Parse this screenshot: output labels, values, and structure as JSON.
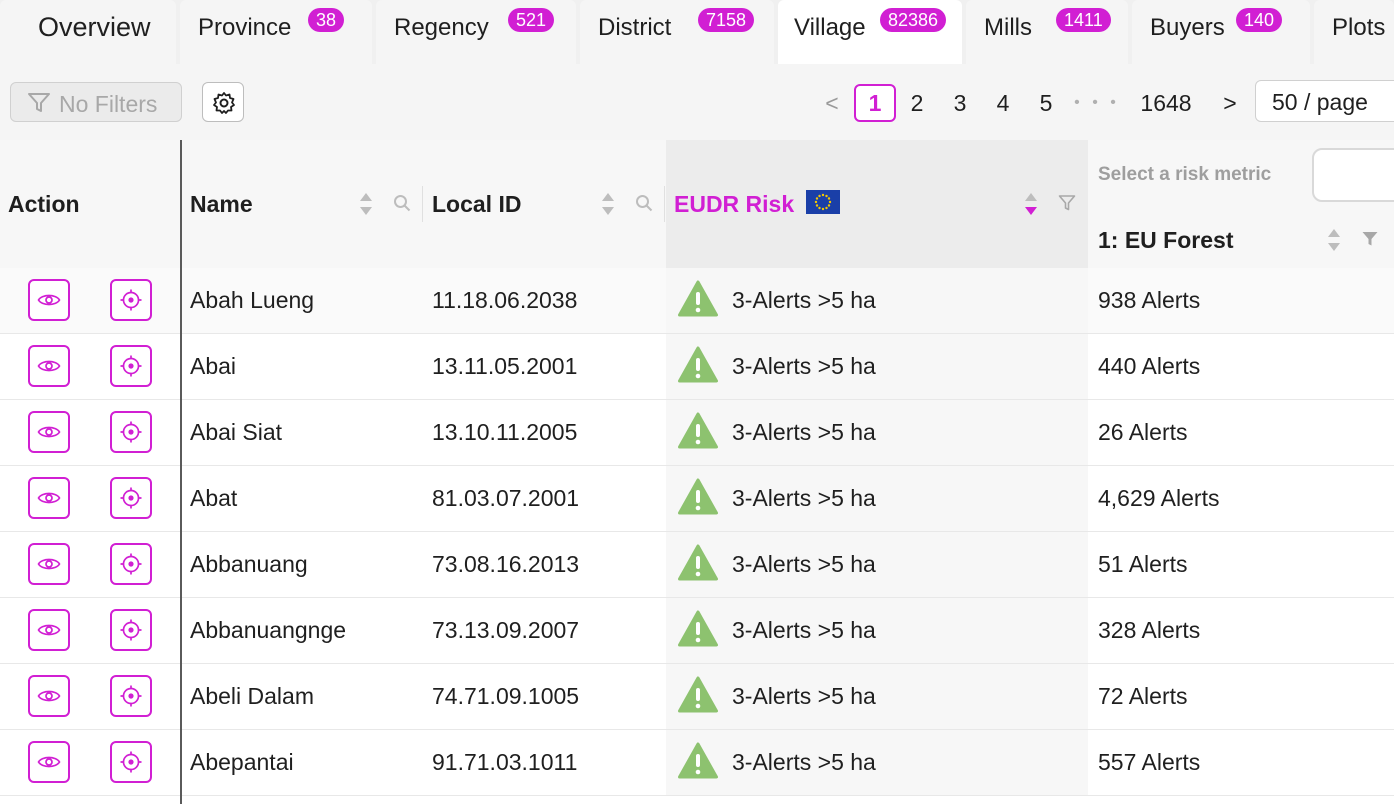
{
  "tabs": [
    {
      "label": "Overview",
      "count": ""
    },
    {
      "label": "Province",
      "count": "38"
    },
    {
      "label": "Regency",
      "count": "521"
    },
    {
      "label": "District",
      "count": "7158"
    },
    {
      "label": "Village",
      "count": "82386"
    },
    {
      "label": "Mills",
      "count": "1411"
    },
    {
      "label": "Buyers",
      "count": "140"
    },
    {
      "label": "Plots",
      "count": ""
    }
  ],
  "active_tab": "Village",
  "toolbar": {
    "filter_label": "No Filters",
    "pagination": {
      "prev": "<",
      "pages": [
        "1",
        "2",
        "3",
        "4",
        "5"
      ],
      "current": "1",
      "ellipsis": "• • •",
      "last": "1648",
      "next": ">"
    },
    "page_size": "50 / page"
  },
  "table": {
    "headers": {
      "action": "Action",
      "name": "Name",
      "local_id": "Local ID",
      "eudr_risk": "EUDR Risk",
      "metric_prompt": "Select a risk metric",
      "metric": "1: EU Forest"
    },
    "rows": [
      {
        "name": "Abah Lueng",
        "local_id": "11.18.06.2038",
        "risk": "3-Alerts >5 ha",
        "alerts": "938 Alerts"
      },
      {
        "name": "Abai",
        "local_id": "13.11.05.2001",
        "risk": "3-Alerts >5 ha",
        "alerts": "440 Alerts"
      },
      {
        "name": "Abai Siat",
        "local_id": "13.10.11.2005",
        "risk": "3-Alerts >5 ha",
        "alerts": "26 Alerts"
      },
      {
        "name": "Abat",
        "local_id": "81.03.07.2001",
        "risk": "3-Alerts >5 ha",
        "alerts": "4,629 Alerts"
      },
      {
        "name": "Abbanuang",
        "local_id": "73.08.16.2013",
        "risk": "3-Alerts >5 ha",
        "alerts": "51 Alerts"
      },
      {
        "name": "Abbanuangnge",
        "local_id": "73.13.09.2007",
        "risk": "3-Alerts >5 ha",
        "alerts": "328 Alerts"
      },
      {
        "name": "Abeli Dalam",
        "local_id": "74.71.09.1005",
        "risk": "3-Alerts >5 ha",
        "alerts": "72 Alerts"
      },
      {
        "name": "Abepantai",
        "local_id": "91.71.03.1011",
        "risk": "3-Alerts >5 ha",
        "alerts": "557 Alerts"
      }
    ]
  },
  "colors": {
    "accent": "#d11fd3",
    "warning": "#8dc26f",
    "eu_flag": "#1a3fa8",
    "eu_star": "#f3c800"
  }
}
